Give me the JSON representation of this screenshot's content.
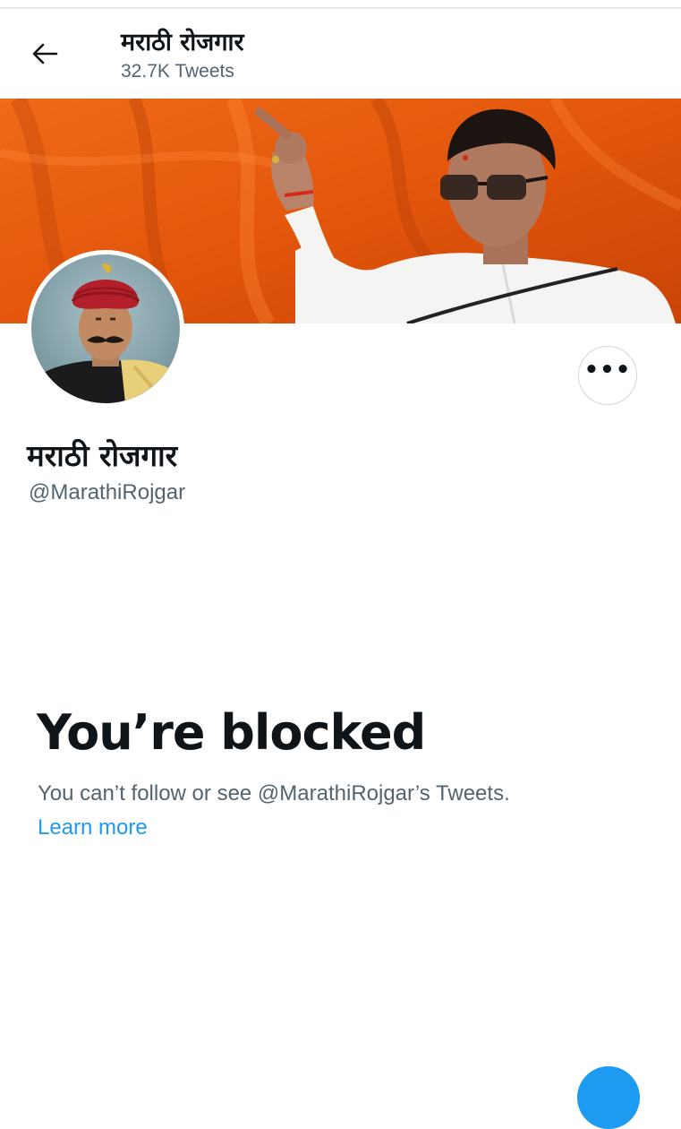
{
  "header": {
    "title": "मराठी रोजगार",
    "tweet_count": "32.7K Tweets"
  },
  "profile": {
    "name": "मराठी रोजगार",
    "handle": "@MarathiRojgar"
  },
  "blocked": {
    "title": "You’re blocked",
    "message": "You can’t follow or see @MarathiRojgar’s Tweets.",
    "learn_more": "Learn more"
  },
  "more_button": {
    "label": "•••"
  },
  "colors": {
    "accent": "#1d9bf0",
    "secondary_text": "#536471",
    "banner_orange": "#e8580e"
  },
  "icons": {
    "back": "arrow-left-icon",
    "more": "more-horizontal-icon"
  }
}
